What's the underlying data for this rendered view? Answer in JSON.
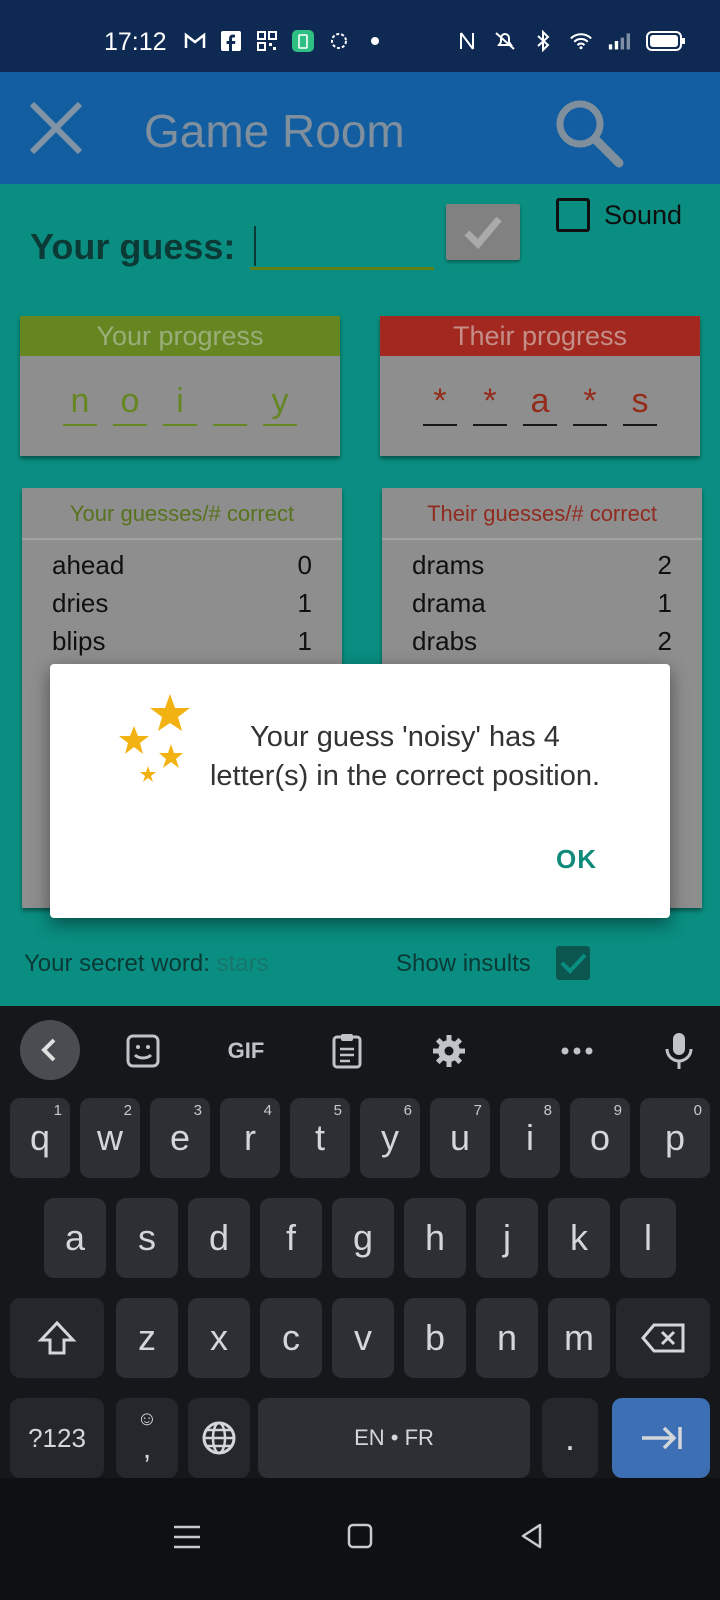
{
  "status_bar": {
    "time": "17:12",
    "left_icons": [
      "gmail-icon",
      "facebook-icon",
      "qr-icon",
      "battery-app-icon",
      "game-icon",
      "dot-icon"
    ],
    "right_icons": [
      "nfc-icon",
      "mute-icon",
      "bluetooth-icon",
      "wifi-icon",
      "signal-icon",
      "battery-icon"
    ]
  },
  "app_bar": {
    "title": "Game Room",
    "close_icon": "close-icon",
    "search_icon": "search-icon"
  },
  "guess": {
    "label": "Your guess:",
    "value": ""
  },
  "sound": {
    "label": "Sound",
    "checked": false
  },
  "your_progress": {
    "title": "Your progress",
    "letters": [
      "n",
      "o",
      "i",
      "",
      "y"
    ]
  },
  "their_progress": {
    "title": "Their progress",
    "letters": [
      "*",
      "*",
      "a",
      "*",
      "s"
    ]
  },
  "your_guesses": {
    "title": "Your guesses/# correct",
    "rows": [
      {
        "word": "ahead",
        "count": "0"
      },
      {
        "word": "dries",
        "count": "1"
      },
      {
        "word": "blips",
        "count": "1"
      }
    ]
  },
  "their_guesses": {
    "title": "Their guesses/# correct",
    "rows": [
      {
        "word": "drams",
        "count": "2"
      },
      {
        "word": "drama",
        "count": "1"
      },
      {
        "word": "drabs",
        "count": "2"
      }
    ]
  },
  "footer": {
    "secret_label": "Your secret word:",
    "secret_value": "stars",
    "insults_label": "Show insults",
    "insults_checked": true
  },
  "dialog": {
    "message": "Your guess 'noisy' has 4 letter(s) in the correct position.",
    "ok_label": "OK"
  },
  "keyboard": {
    "gif_label": "GIF",
    "row1": [
      {
        "k": "q",
        "n": "1"
      },
      {
        "k": "w",
        "n": "2"
      },
      {
        "k": "e",
        "n": "3"
      },
      {
        "k": "r",
        "n": "4"
      },
      {
        "k": "t",
        "n": "5"
      },
      {
        "k": "y",
        "n": "6"
      },
      {
        "k": "u",
        "n": "7"
      },
      {
        "k": "i",
        "n": "8"
      },
      {
        "k": "o",
        "n": "9"
      },
      {
        "k": "p",
        "n": "0"
      }
    ],
    "row2": [
      "a",
      "s",
      "d",
      "f",
      "g",
      "h",
      "j",
      "k",
      "l"
    ],
    "row3": [
      "z",
      "x",
      "c",
      "v",
      "b",
      "n",
      "m"
    ],
    "symbols_label": "?123",
    "comma_label": ",",
    "space_label": "EN • FR",
    "period_label": "."
  }
}
